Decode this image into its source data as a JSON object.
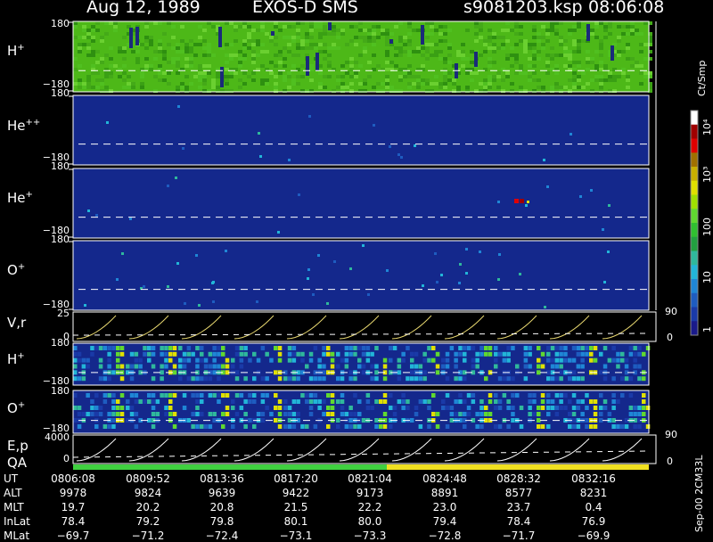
{
  "header": {
    "date": "Aug 12, 1989",
    "instrument": "EXOS-D SMS",
    "file": "s9081203.ksp",
    "time": "08:06:08"
  },
  "colorbar": {
    "unit": "Ct/Smp",
    "tick_labels": [
      "1",
      "10",
      "100",
      "10³",
      "10⁴"
    ],
    "colors": [
      "#1a1a8a",
      "#1a3aa8",
      "#1e5cc0",
      "#1f86d6",
      "#22b5d8",
      "#2fb89c",
      "#22a040",
      "#30c030",
      "#60d830",
      "#a0e000",
      "#e0e000",
      "#c8b000",
      "#a07000",
      "#e00000",
      "#a00000",
      "#ffffff"
    ]
  },
  "footer_id": "Sep-00 2CM33L",
  "panels": [
    {
      "id": "p1",
      "label": "H",
      "sup": "+",
      "ymax": "180",
      "ymin": "−180",
      "base": "#4db818",
      "ylim": [
        -180,
        180
      ]
    },
    {
      "id": "p2",
      "label": "He",
      "sup": "++",
      "ymax": "180",
      "ymin": "−180",
      "base": "#14288c",
      "ylim": [
        -180,
        180
      ]
    },
    {
      "id": "p3",
      "label": "He",
      "sup": "+",
      "ymax": "180",
      "ymin": "−180",
      "base": "#14288c",
      "ylim": [
        -180,
        180
      ]
    },
    {
      "id": "p4",
      "label": "O",
      "sup": "+",
      "ymax": "180",
      "ymin": "−180",
      "base": "#14288c",
      "ylim": [
        -180,
        180
      ]
    }
  ],
  "vr_panel": {
    "label": "V,r",
    "left_top": "25",
    "left_bottom": "0",
    "right_top": "90",
    "right_bottom": "0"
  },
  "sweep_panels": [
    {
      "id": "s1",
      "label": "H",
      "sup": "+",
      "ymax": "180",
      "ymin": "−180"
    },
    {
      "id": "s2",
      "label": "O",
      "sup": "+",
      "ymax": "180",
      "ymin": "−180"
    }
  ],
  "ep_panel": {
    "label": "E,p",
    "qa_label": "QA",
    "left_top": "4000",
    "left_bottom": "0",
    "right_top": "90",
    "right_bottom": "0"
  },
  "qa_bar": {
    "colors": [
      "#40d040",
      "#f0e020"
    ],
    "change_time": "0823:30"
  },
  "chart_data": {
    "type": "heatmap",
    "title": "Aug 12, 1989   EXOS-D SMS",
    "x_label": "UT",
    "x_ticks": [
      "0806:08",
      "0809:52",
      "0813:36",
      "0817:20",
      "0821:04",
      "0824:48",
      "0828:32",
      "0832:16"
    ],
    "colorbar_scale": "log",
    "colorbar_range": [
      1,
      10000
    ],
    "ephemeris": [
      {
        "name": "UT",
        "values": [
          "0806:08",
          "0809:52",
          "0813:36",
          "0817:20",
          "0821:04",
          "0824:48",
          "0828:32",
          "0832:16"
        ]
      },
      {
        "name": "ALT",
        "values": [
          "9978",
          "9824",
          "9639",
          "9422",
          "9173",
          "8891",
          "8577",
          "8231"
        ]
      },
      {
        "name": "MLT",
        "values": [
          "19.7",
          "20.2",
          "20.8",
          "21.5",
          "22.2",
          "23.0",
          "23.7",
          "0.4"
        ]
      },
      {
        "name": "InLat",
        "values": [
          "78.4",
          "79.2",
          "79.8",
          "80.1",
          "80.0",
          "79.4",
          "78.4",
          "76.9"
        ]
      },
      {
        "name": "MLat",
        "values": [
          "−69.7",
          "−71.2",
          "−72.4",
          "−73.1",
          "−73.3",
          "−72.8",
          "−71.7",
          "−69.9"
        ]
      }
    ]
  }
}
